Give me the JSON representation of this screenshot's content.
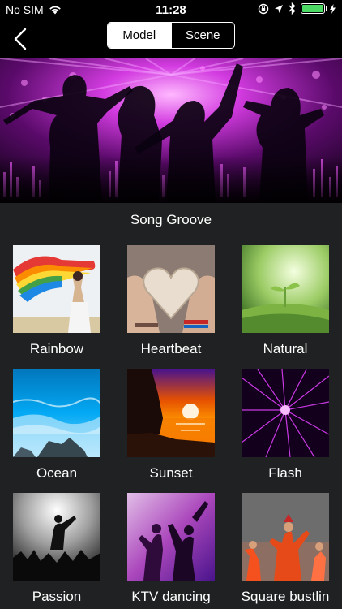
{
  "status": {
    "carrier": "No SIM",
    "time": "11:28",
    "wifi_icon": "wifi-icon",
    "lock_icon": "orientation-lock-icon",
    "location_icon": "location-arrow-icon",
    "bluetooth_icon": "bluetooth-icon",
    "battery_icon": "battery-charging-icon",
    "battery_color": "#4cd964",
    "battery_level": 1.0
  },
  "nav": {
    "back_icon": "chevron-left-icon",
    "tabs": [
      {
        "label": "Model",
        "selected": true
      },
      {
        "label": "Scene",
        "selected": false
      }
    ]
  },
  "banner": {
    "image": "concert-crowd-silhouettes-purple-lights",
    "accent_color": "#d23be0"
  },
  "section": {
    "title": "Song Groove"
  },
  "modes": [
    {
      "label": "Rainbow",
      "image": "rainbow-flag-woman"
    },
    {
      "label": "Heartbeat",
      "image": "heart-in-hands"
    },
    {
      "label": "Natural",
      "image": "green-sprout"
    },
    {
      "label": "Ocean",
      "image": "ocean-waves"
    },
    {
      "label": "Sunset",
      "image": "sunset-over-sea"
    },
    {
      "label": "Flash",
      "image": "purple-laser-beams"
    },
    {
      "label": "Passion",
      "image": "concert-crowd-bw"
    },
    {
      "label": "KTV dancing",
      "image": "dancers-purple-light"
    },
    {
      "label": "Square bustlin",
      "image": "folk-dancers"
    }
  ]
}
